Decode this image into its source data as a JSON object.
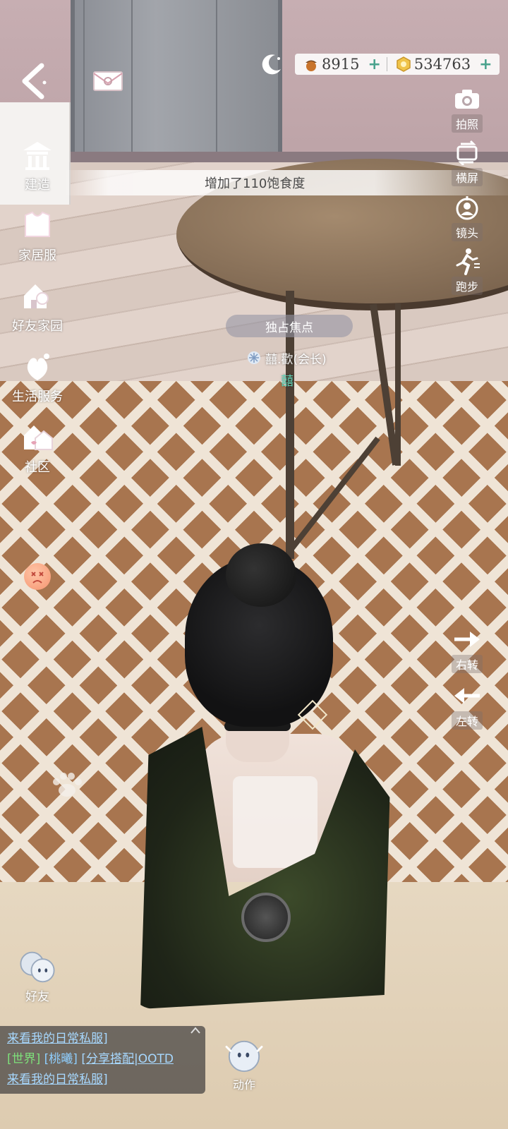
{
  "currency": {
    "acorns": "8915",
    "gold": "534763"
  },
  "left_menu": [
    {
      "label": "建造",
      "icon": "build-icon"
    },
    {
      "label": "家居服",
      "icon": "homewear-icon"
    },
    {
      "label": "好友家园",
      "icon": "friend-home-icon"
    },
    {
      "label": "生活服务",
      "icon": "life-service-icon"
    },
    {
      "label": "社区",
      "icon": "community-icon"
    }
  ],
  "right_menu": [
    {
      "label": "拍照",
      "icon": "camera-icon"
    },
    {
      "label": "横屏",
      "icon": "rotate-screen-icon"
    },
    {
      "label": "镜头",
      "icon": "lens-icon"
    },
    {
      "label": "跑步",
      "icon": "run-icon"
    },
    {
      "label": "右转",
      "icon": "arrow-right-icon"
    },
    {
      "label": "左转",
      "icon": "arrow-left-icon"
    }
  ],
  "toast": "增加了110饱食度",
  "focus_label": "独占焦点",
  "player": {
    "name": "囍.歡(会长)",
    "guild_badge": "囍"
  },
  "friends_label": "好友",
  "action_label": "动作",
  "chat": {
    "line1": "来看我的日常私服]",
    "channel": "[世界]",
    "user": "[桃曦]",
    "message": "[分享搭配|OOTD",
    "line3": "来看我的日常私服]"
  },
  "colors": {
    "accent_green": "#4aa38e",
    "world_channel": "#7ee07a",
    "link_blue": "#a7d8ff"
  }
}
